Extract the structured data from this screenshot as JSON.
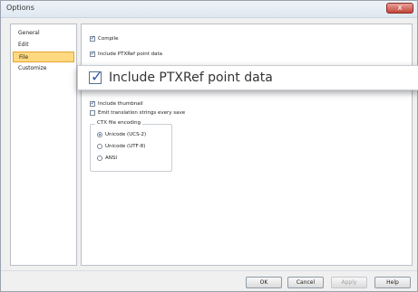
{
  "window": {
    "title": "Options",
    "close_glyph": "x"
  },
  "nav": {
    "items": [
      {
        "label": "General"
      },
      {
        "label": "Edit"
      },
      {
        "label": "File"
      },
      {
        "label": "Customize"
      }
    ],
    "selected": "File"
  },
  "options": {
    "compile": {
      "label": "Compile",
      "checked": true
    },
    "include_ptxref_small": {
      "label": "Include PTXRef point data",
      "checked": true
    },
    "include_ptxref_zoom": {
      "label": "Include PTXRef point data",
      "checked": true
    },
    "include_thumbnail": {
      "label": "Include thumbnail",
      "checked": true
    },
    "emit_translation": {
      "label": "Emit translation strings every save",
      "checked": false
    }
  },
  "encoding": {
    "title": "CTX file encoding",
    "options": [
      {
        "label": "Unicode (UCS-2)",
        "selected": true
      },
      {
        "label": "Unicode (UTF-8)",
        "selected": false
      },
      {
        "label": "ANSI",
        "selected": false
      }
    ]
  },
  "buttons": {
    "ok": "OK",
    "cancel": "Cancel",
    "apply": "Apply",
    "help": "Help"
  },
  "colors": {
    "selected_nav": "#ffd980",
    "checkmark": "#2b5aa8"
  }
}
